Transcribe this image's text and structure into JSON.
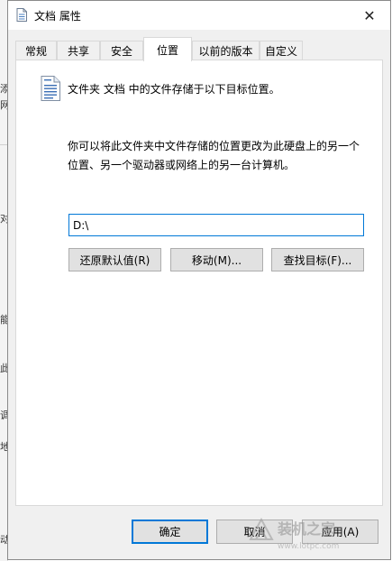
{
  "dialog": {
    "title": "文档 属性",
    "title_icon": "document-icon",
    "close_glyph": "✕"
  },
  "tabs": [
    {
      "label": "常规"
    },
    {
      "label": "共享"
    },
    {
      "label": "安全"
    },
    {
      "label": "位置",
      "active": true
    },
    {
      "label": "以前的版本"
    },
    {
      "label": "自定义"
    }
  ],
  "location_tab": {
    "intro": "文件夹 文档 中的文件存储于以下目标位置。",
    "description_line1": "你可以将此文件夹中文件存储的位置更改为此硬盘上的另一个",
    "description_line2": "位置、另一个驱动器或网络上的另一台计算机。",
    "path_value": "D:\\",
    "restore_default_label": "还原默认值(R)",
    "move_label": "移动(M)...",
    "find_target_label": "查找目标(F)..."
  },
  "footer": {
    "ok_label": "确定",
    "cancel_label": "取消",
    "apply_label": "应用(A)"
  },
  "background_fragments": [
    "添",
    "网",
    "对",
    "能",
    "此",
    "调",
    "地",
    "动"
  ],
  "watermark": {
    "text": "装机之家",
    "url": "www.lotpc.com"
  },
  "colors": {
    "accent": "#0078d7",
    "dialog_bg": "#f0f0f0",
    "button_bg": "#e1e1e1"
  }
}
